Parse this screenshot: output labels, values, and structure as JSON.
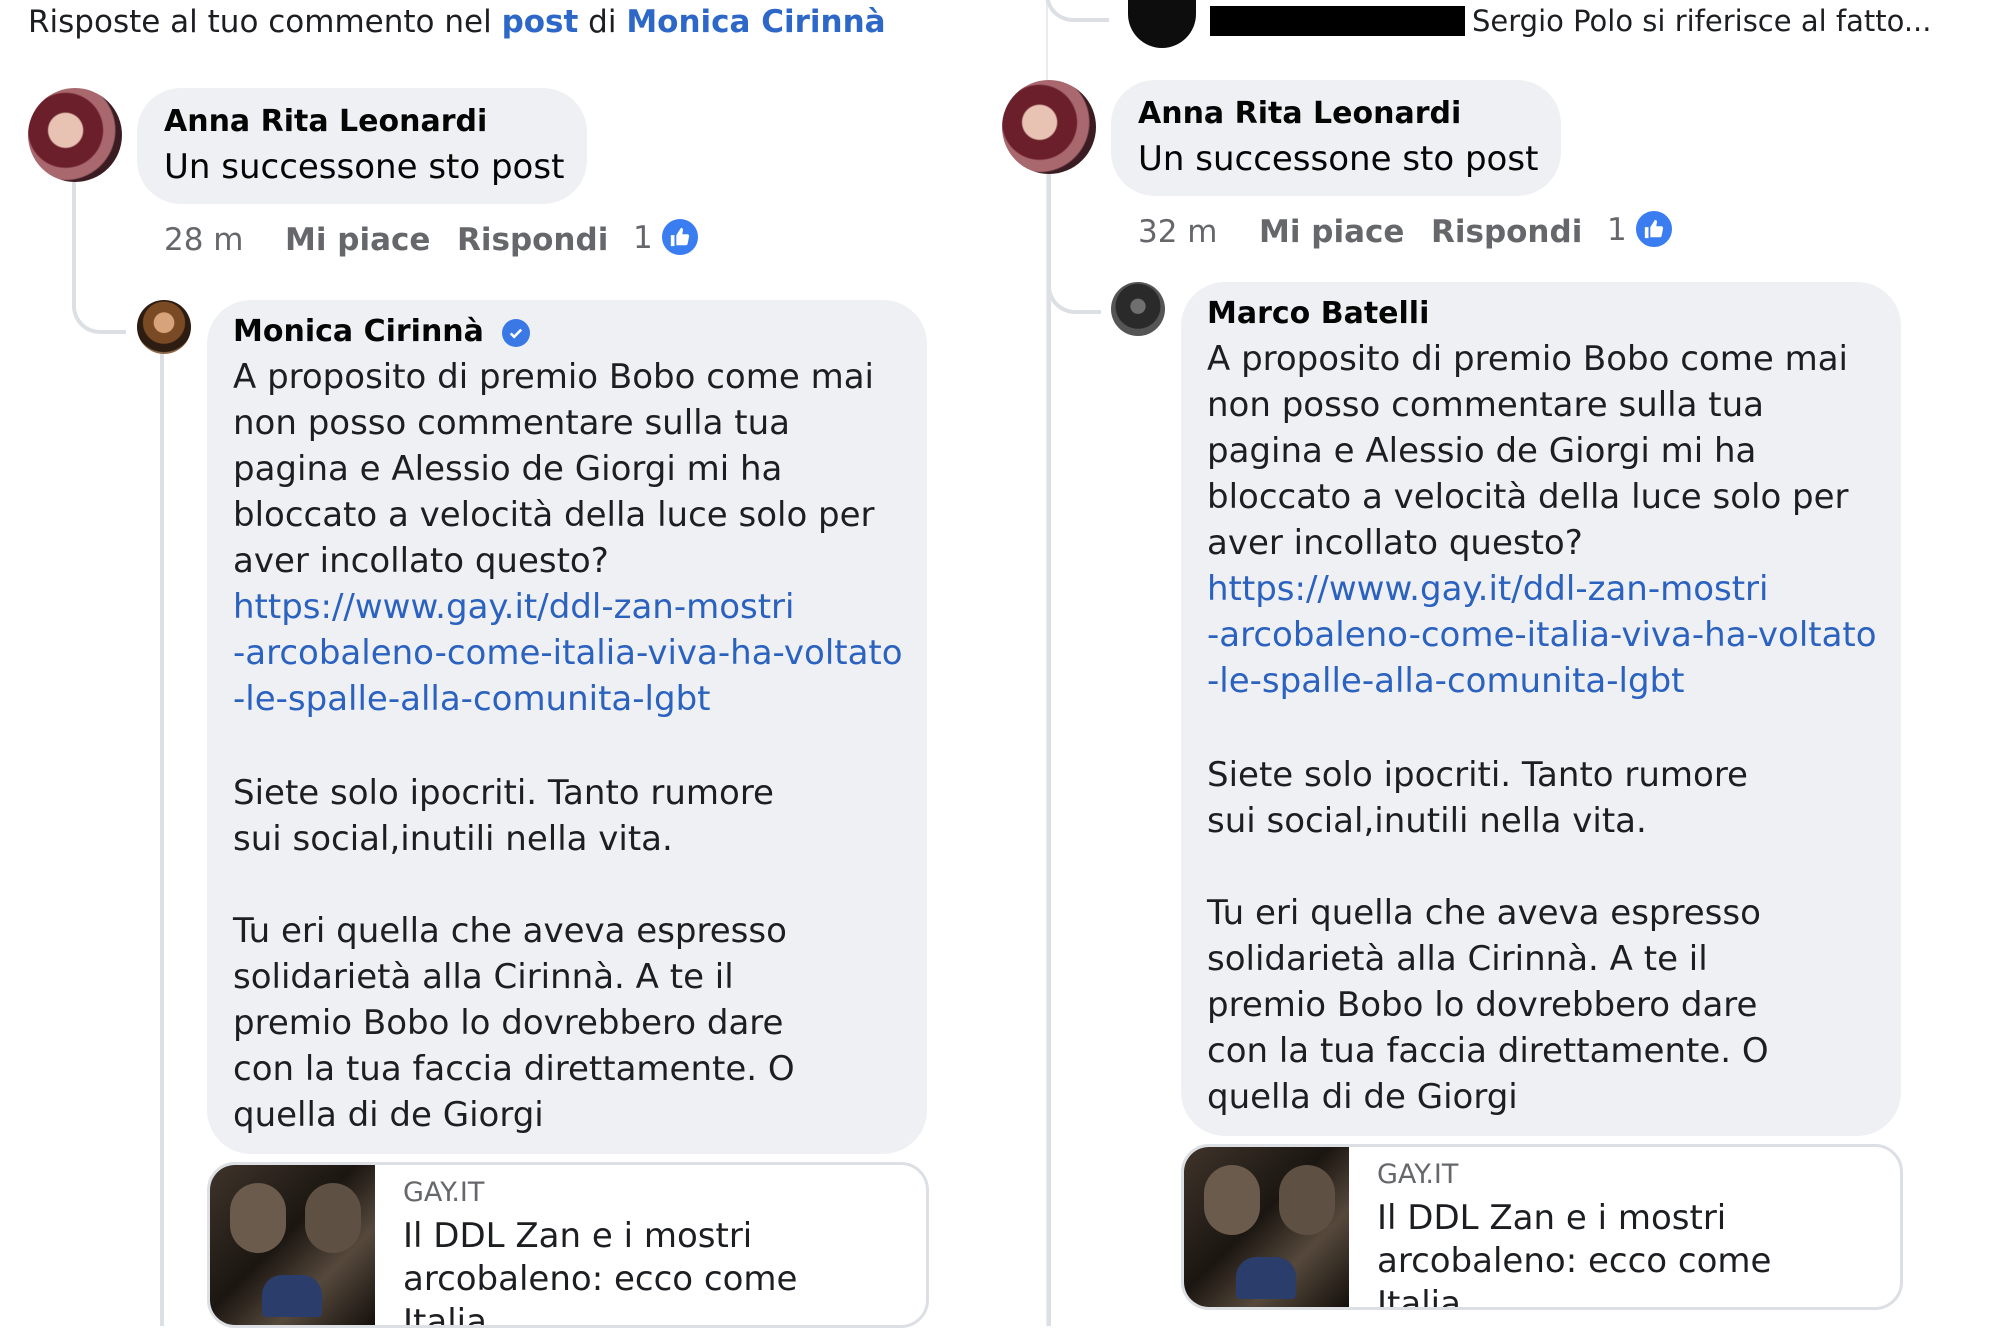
{
  "left": {
    "header": {
      "prefix": "Risposte al tuo commento nel ",
      "link_post": "post",
      "mid": " di ",
      "link_author": "Monica Cirinnà"
    },
    "parent": {
      "author": "Anna Rita Leonardi",
      "text": "Un successone sto post",
      "time": "28 m",
      "like_label": "Mi piace",
      "reply_label": "Rispondi",
      "like_count": "1"
    },
    "reply": {
      "author": "Monica Cirinnà",
      "verified": true,
      "intro": "A proposito di premio Bobo come mai non posso commentare sulla tua pagina e Alessio de Giorgi mi ha bloccato a velocità della luce solo per aver incollato questo?",
      "url_lines": [
        "https://www.gay.it/ddl-zan-mostri",
        "-arcobaleno-come-italia-viva-ha-voltato",
        "-le-spalle-alla-comunita-lgbt"
      ],
      "para2": "Siete solo ipocriti. Tanto rumore sui social,inutili nella vita.",
      "para3": "Tu eri quella che aveva espresso solidarietà alla Cirinnà. A te il premio Bobo lo dovrebbero dare con la tua faccia direttamente. O quella di de Giorgi"
    },
    "card": {
      "site": "GAY.IT",
      "title": "Il DDL Zan e i mostri\narcobaleno: ecco come Italia..."
    }
  },
  "right": {
    "top_snippet": "Sergio Polo si riferisce al fatto...",
    "parent": {
      "author": "Anna Rita Leonardi",
      "text": "Un successone sto post",
      "time": "32 m",
      "like_label": "Mi piace",
      "reply_label": "Rispondi",
      "like_count": "1"
    },
    "reply": {
      "author": "Marco Batelli",
      "intro": "A proposito di premio Bobo come mai non posso commentare sulla tua pagina e Alessio de Giorgi mi ha bloccato a velocità della luce solo per aver incollato questo?",
      "url_lines": [
        "https://www.gay.it/ddl-zan-mostri",
        "-arcobaleno-come-italia-viva-ha-voltato",
        "-le-spalle-alla-comunita-lgbt"
      ],
      "para2": "Siete solo ipocriti. Tanto rumore sui social,inutili nella vita.",
      "para3": "Tu eri quella che aveva espresso solidarietà alla Cirinnà. A te il premio Bobo lo dovrebbero dare con la tua faccia direttamente. O quella di de Giorgi"
    },
    "card": {
      "site": "GAY.IT",
      "title": "Il DDL Zan e i mostri\narcobaleno: ecco come Italia..."
    }
  },
  "colors": {
    "link": "#2d67c7",
    "bubble": "#eef0f3",
    "meta": "#65676b",
    "like_badge": "#3a7df0"
  }
}
